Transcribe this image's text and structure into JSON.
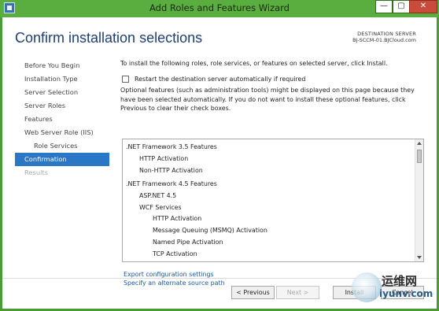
{
  "window": {
    "title": "Add Roles and Features Wizard",
    "min_glyph": "—",
    "restore_glyph": "▢",
    "close_glyph": "✕"
  },
  "header": {
    "title": "Confirm installation selections",
    "destination_label": "DESTINATION SERVER",
    "destination_server": "BJ-SCCM-01.BJCloud.com"
  },
  "nav": {
    "items": [
      {
        "label": "Before You Begin",
        "state": "normal"
      },
      {
        "label": "Installation Type",
        "state": "normal"
      },
      {
        "label": "Server Selection",
        "state": "normal"
      },
      {
        "label": "Server Roles",
        "state": "normal"
      },
      {
        "label": "Features",
        "state": "normal"
      },
      {
        "label": "Web Server Role (IIS)",
        "state": "normal"
      },
      {
        "label": "Role Services",
        "state": "sub"
      },
      {
        "label": "Confirmation",
        "state": "active"
      },
      {
        "label": "Results",
        "state": "disabled"
      }
    ]
  },
  "content": {
    "intro": "To install the following roles, role services, or features on selected server, click Install.",
    "restart_label": "Restart the destination server automatically if required",
    "restart_checked": false,
    "optional_text": "Optional features (such as administration tools) might be displayed on this page because they have been selected automatically. If you do not want to install these optional features, click Previous to clear their check boxes.",
    "features": [
      ".NET Framework 3.5 Features",
      "HTTP Activation",
      "Non-HTTP Activation",
      ".NET Framework 4.5 Features",
      "ASP.NET 4.5",
      "WCF Services",
      "HTTP Activation",
      "Message Queuing (MSMQ) Activation",
      "Named Pipe Activation",
      "TCP Activation"
    ],
    "export_link": "Export configuration settings",
    "alternate_link": "Specify an alternate source path"
  },
  "footer": {
    "previous": "< Previous",
    "next": "Next >",
    "install": "Install",
    "cancel": "Cancel"
  },
  "watermark": {
    "line1": "运维网",
    "line2": "iyunv.com"
  },
  "colors": {
    "titlebar": "#5aad3f",
    "header_title": "#1e3f73",
    "nav_active": "#2a77c6",
    "link": "#1a5aa3"
  }
}
